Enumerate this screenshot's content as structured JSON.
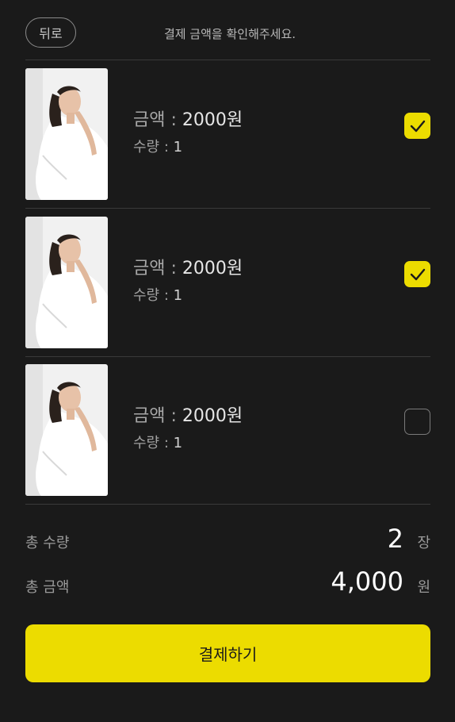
{
  "header": {
    "back_label": "뒤로",
    "message": "결제 금액을 확인해주세요."
  },
  "items": [
    {
      "price_label": "금액 :",
      "price_value": "2000원",
      "qty_label": "수량 :",
      "qty_value": "1",
      "checked": true
    },
    {
      "price_label": "금액 :",
      "price_value": "2000원",
      "qty_label": "수량 :",
      "qty_value": "1",
      "checked": true
    },
    {
      "price_label": "금액 :",
      "price_value": "2000원",
      "qty_label": "수량 :",
      "qty_value": "1",
      "checked": false
    }
  ],
  "summary": {
    "total_qty_label": "총 수량",
    "total_qty_value": "2",
    "total_qty_unit": "장",
    "total_amount_label": "총 금액",
    "total_amount_value": "4,000",
    "total_amount_unit": "원"
  },
  "pay_button_label": "결제하기",
  "colors": {
    "background": "#1a1a1a",
    "accent": "#ecdc00",
    "divider": "#3a3a3a"
  }
}
